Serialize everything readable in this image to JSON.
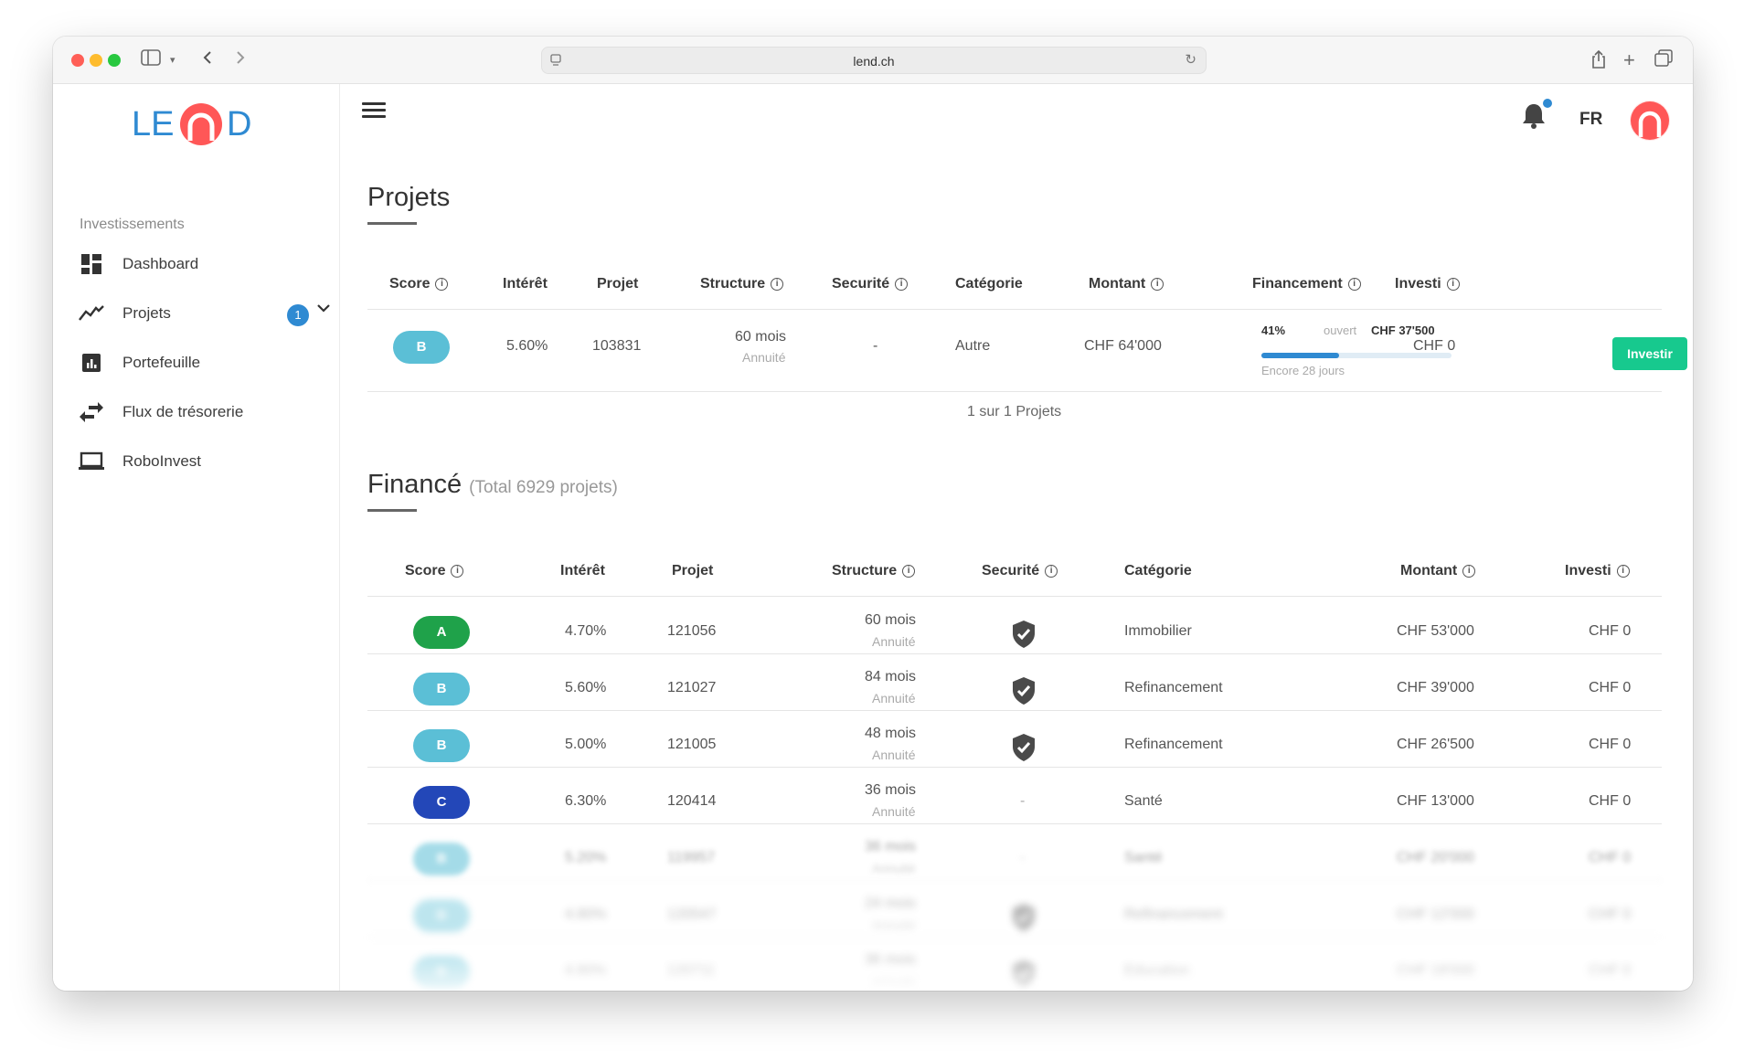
{
  "browser": {
    "url": "lend.ch"
  },
  "brand": {
    "accent": "#ff5757",
    "blue": "#2f8ad2",
    "green": "#17c98e"
  },
  "sidebar": {
    "heading": "Investissements",
    "items": [
      {
        "label": "Dashboard",
        "icon": "dashboard-icon"
      },
      {
        "label": "Projets",
        "icon": "trend-icon",
        "badge": "1"
      },
      {
        "label": "Portefeuille",
        "icon": "bar-chart-icon"
      },
      {
        "label": "Flux de trésorerie",
        "icon": "transfer-icon"
      },
      {
        "label": "RoboInvest",
        "icon": "laptop-icon"
      }
    ]
  },
  "topbar": {
    "lang": "FR"
  },
  "projets": {
    "title": "Projets",
    "headers": [
      "Score",
      "Intérêt",
      "Projet",
      "Structure",
      "Securité",
      "Catégorie",
      "Montant",
      "Financement",
      "Investi"
    ],
    "row": {
      "score": "B",
      "score_color": "#5bbfd6",
      "interest": "5.60%",
      "project": "103831",
      "structure": "60 mois",
      "structure_type": "Annuité",
      "security": "-",
      "category": "Autre",
      "amount": "CHF 64'000",
      "funding_pct": "41%",
      "funding_fraction": 0.41,
      "funding_open_label": "ouvert",
      "funding_open_amount": "CHF 37'500",
      "funding_remaining": "Encore 28 jours",
      "invested": "CHF 0",
      "action": "Investir"
    },
    "pagination": "1 sur 1 Projets"
  },
  "finance": {
    "title": "Financé",
    "subtitle": "(Total 6929 projets)",
    "headers": [
      "Score",
      "Intérêt",
      "Projet",
      "Structure",
      "Securité",
      "Catégorie",
      "Montant",
      "Investi"
    ],
    "rows": [
      {
        "score": "A",
        "color": "#1fa24a",
        "interest": "4.70%",
        "project": "121056",
        "structure": "60 mois",
        "type": "Annuité",
        "security": "shield",
        "category": "Immobilier",
        "amount": "CHF 53'000",
        "invested": "CHF 0"
      },
      {
        "score": "B",
        "color": "#5bbfd6",
        "interest": "5.60%",
        "project": "121027",
        "structure": "84 mois",
        "type": "Annuité",
        "security": "shield",
        "category": "Refinancement",
        "amount": "CHF 39'000",
        "invested": "CHF 0"
      },
      {
        "score": "B",
        "color": "#5bbfd6",
        "interest": "5.00%",
        "project": "121005",
        "structure": "48 mois",
        "type": "Annuité",
        "security": "shield",
        "category": "Refinancement",
        "amount": "CHF 26'500",
        "invested": "CHF 0"
      },
      {
        "score": "C",
        "color": "#2347b8",
        "interest": "6.30%",
        "project": "120414",
        "structure": "36 mois",
        "type": "Annuité",
        "security": "-",
        "category": "Santé",
        "amount": "CHF 13'000",
        "invested": "CHF 0"
      },
      {
        "score": "B",
        "color": "#5bbfd6",
        "interest": "5.20%",
        "project": "119957",
        "structure": "36 mois",
        "type": "Annuité",
        "security": "-",
        "category": "Santé",
        "amount": "CHF 20'000",
        "invested": "CHF 0"
      },
      {
        "score": "B",
        "color": "#5bbfd6",
        "interest": "4.80%",
        "project": "120547",
        "structure": "24 mois",
        "type": "Annuité",
        "security": "shield",
        "category": "Refinancement",
        "amount": "CHF 12'000",
        "invested": "CHF 0"
      },
      {
        "score": "B",
        "color": "#5bbfd6",
        "interest": "4.80%",
        "project": "120711",
        "structure": "36 mois",
        "type": "Annuité",
        "security": "shield",
        "category": "Education",
        "amount": "CHF 18'000",
        "invested": "CHF 0"
      }
    ]
  }
}
